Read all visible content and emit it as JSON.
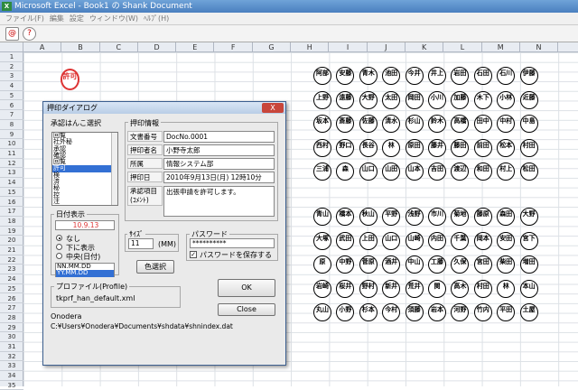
{
  "window": {
    "title": "Microsoft Excel - Book1 の Shank Document",
    "app_icon": "excel-icon"
  },
  "menu": [
    "ファイル(F)",
    "編集",
    "設定",
    "ウィンドウ(W)",
    "ﾍﾙﾌﾟ(H)"
  ],
  "toolbar": [
    {
      "icon": "stamp-icon",
      "glyph": "@"
    },
    {
      "icon": "help-icon",
      "glyph": "?"
    }
  ],
  "columns": [
    "A",
    "B",
    "C",
    "D",
    "E",
    "F",
    "G",
    "H",
    "I",
    "J",
    "K",
    "L",
    "M",
    "N"
  ],
  "rows": [
    "1",
    "2",
    "3",
    "4",
    "5",
    "6",
    "7",
    "8",
    "9",
    "10",
    "11",
    "12",
    "13",
    "14",
    "15",
    "16",
    "17",
    "18",
    "19",
    "20",
    "21",
    "22",
    "23",
    "24",
    "25",
    "26",
    "27",
    "28",
    "29",
    "30",
    "31",
    "32",
    "33",
    "34",
    "35"
  ],
  "red_seal": "許可",
  "seals_top": [
    [
      "阿部",
      "安藤",
      "青木",
      "池田",
      "今井",
      "井上",
      "岩田",
      "石田",
      "石川",
      "伊藤"
    ],
    [
      "上野",
      "遠藤",
      "大野",
      "太田",
      "岡田",
      "小川",
      "加藤",
      "木下",
      "小林",
      "近藤"
    ],
    [
      "坂本",
      "斎藤",
      "佐藤",
      "清水",
      "杉山",
      "鈴木",
      "高橋",
      "田中",
      "中村",
      "中島"
    ],
    [
      "西村",
      "野口",
      "長谷",
      "林",
      "原田",
      "藤井",
      "藤田",
      "前田",
      "松本",
      "村田"
    ],
    [
      "三浦",
      "森",
      "山口",
      "山田",
      "山本",
      "吉田",
      "渡辺",
      "和田",
      "村上",
      "松田"
    ]
  ],
  "seals_bottom": [
    [
      "青山",
      "橋本",
      "秋山",
      "平野",
      "浅野",
      "市川",
      "菊地",
      "藤原",
      "森田",
      "大野"
    ],
    [
      "大塚",
      "武田",
      "上田",
      "山口",
      "山崎",
      "内田",
      "千葉",
      "岡本",
      "安田",
      "宮下"
    ],
    [
      "原",
      "中野",
      "菅原",
      "酒井",
      "中山",
      "工藤",
      "久保",
      "宮田",
      "柴田",
      "増田"
    ],
    [
      "岩崎",
      "桜井",
      "野村",
      "新井",
      "荒井",
      "関",
      "高木",
      "村田",
      "林",
      "本山"
    ],
    [
      "丸山",
      "小野",
      "杉本",
      "今村",
      "須藤",
      "岩本",
      "河野",
      "竹内",
      "平田",
      "土屋"
    ]
  ],
  "dialog": {
    "title": "押印ダイアログ",
    "close_label": "X",
    "stamp_select": {
      "label": "承認はんこ選択",
      "items": [
        "回覧",
        "社外秘",
        "承認",
        "確認",
        "回覧",
        "許可",
        "検",
        "済",
        "秘",
        "控",
        "注"
      ],
      "selected_index": 5
    },
    "stamp_info": {
      "label": "押印情報",
      "doc_no_label": "文書番号",
      "doc_no": "DocNo.0001",
      "stamper_label": "押印者名",
      "stamper": "小野寺太郎",
      "dept_label": "所属",
      "dept": "情報システム部",
      "date_label": "押印日",
      "date": "2010年9月13日(月) 12時10分",
      "item_label": "承認項目(ｺﾒﾝﾄ)",
      "item": "出張申請を許可します。"
    },
    "date_display": {
      "label": "日付表示",
      "preview": "10.9.13",
      "options": [
        "なし",
        "下に表示",
        "中央(日付)"
      ],
      "selected_option": 0,
      "formats": [
        "NN.MM.DD",
        "YY.MM.DD"
      ],
      "selected_format": 1
    },
    "size": {
      "label": "ｻｲｽﾞ",
      "value": "11",
      "unit": "(MM)"
    },
    "password": {
      "label": "パスワード",
      "value": "**********",
      "save_label": "パスワードを保存する",
      "save_checked": true
    },
    "color_button": "色選択",
    "profile": {
      "label": "プロファイル(Profile)",
      "value": "tkprf_han_default.xml"
    },
    "ok_button": "OK",
    "close_button": "Close",
    "user": "Onodera",
    "data_path": "C:¥Users¥Onodera¥Documents¥shdata¥shnindex.dat"
  }
}
